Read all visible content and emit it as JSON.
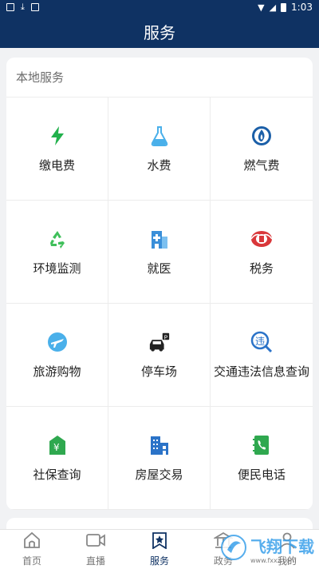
{
  "status_bar": {
    "time": "1:03"
  },
  "header": {
    "title": "服务"
  },
  "section": {
    "title": "本地服务"
  },
  "services": [
    {
      "label": "缴电费",
      "icon": "lightning-icon",
      "color": "#22b14c"
    },
    {
      "label": "水费",
      "icon": "flask-icon",
      "color": "#4ab0ea"
    },
    {
      "label": "燃气费",
      "icon": "gas-flame-icon",
      "color": "#1b5fa8"
    },
    {
      "label": "环境监测",
      "icon": "recycle-icon",
      "color": "#3fbf5a"
    },
    {
      "label": "就医",
      "icon": "hospital-icon",
      "color": "#3a8fd9"
    },
    {
      "label": "税务",
      "icon": "tax-emblem-icon",
      "color": "#d9373a"
    },
    {
      "label": "旅游购物",
      "icon": "plane-icon",
      "color": "#4ab0ea"
    },
    {
      "label": "停车场",
      "icon": "parking-car-icon",
      "color": "#222222"
    },
    {
      "label": "交通违法信息查询",
      "icon": "traffic-violation-icon",
      "color": "#2b73c8"
    },
    {
      "label": "社保查询",
      "icon": "social-security-icon",
      "color": "#2fa84f"
    },
    {
      "label": "房屋交易",
      "icon": "buildings-icon",
      "color": "#2b73c8"
    },
    {
      "label": "便民电话",
      "icon": "phone-book-icon",
      "color": "#2fa84f"
    }
  ],
  "tabs": [
    {
      "label": "首页",
      "icon": "home-icon",
      "active": false
    },
    {
      "label": "直播",
      "icon": "video-icon",
      "active": false
    },
    {
      "label": "服务",
      "icon": "star-bookmark-icon",
      "active": true
    },
    {
      "label": "政务",
      "icon": "government-icon",
      "active": false
    },
    {
      "label": "我的",
      "icon": "profile-icon",
      "active": false
    }
  ],
  "watermark": {
    "text": "飞翔下载",
    "url": "www.fxxz.com"
  }
}
